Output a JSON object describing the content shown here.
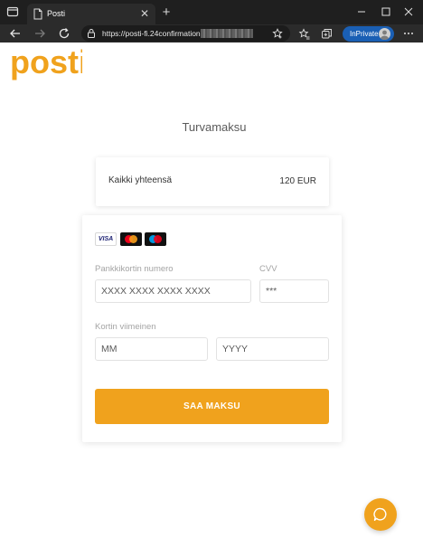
{
  "browser": {
    "tab_title": "Posti",
    "url": "https://posti-fi.24confirmation",
    "inprivate_label": "InPrivate"
  },
  "page": {
    "logo_text": "posti",
    "heading": "Turvamaksu",
    "summary": {
      "label": "Kaikki yhteensä",
      "amount": "120 EUR"
    },
    "card_brands": [
      "visa",
      "mastercard",
      "maestro"
    ],
    "visa_text": "VISA",
    "form": {
      "card_number_label": "Pankkikortin numero",
      "card_number_placeholder": "XXXX XXXX XXXX XXXX",
      "cvv_label": "CVV",
      "cvv_placeholder": "***",
      "expiry_label": "Kortin viimeinen",
      "month_placeholder": "MM",
      "year_placeholder": "YYYY"
    },
    "pay_button": "SAA MAKSU"
  },
  "colors": {
    "accent": "#f0a21d",
    "inprivate": "#1a5fb4"
  }
}
